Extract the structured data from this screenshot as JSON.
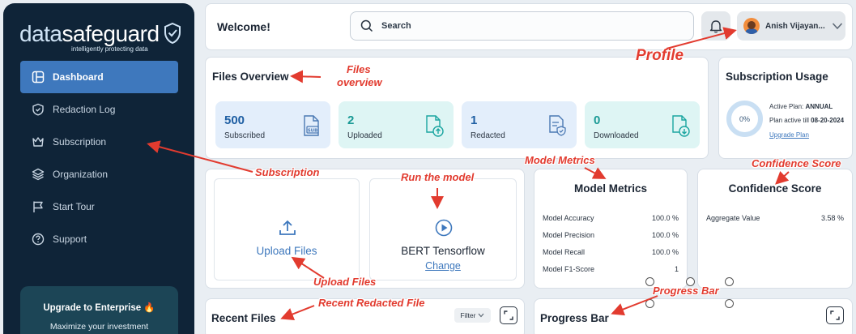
{
  "brand": {
    "name_part1": "data",
    "name_part2": "safeguard",
    "tagline": "intelligently protecting data"
  },
  "sidebar": {
    "items": [
      {
        "label": "Dashboard",
        "icon": "dashboard-icon"
      },
      {
        "label": "Redaction Log",
        "icon": "shield-icon"
      },
      {
        "label": "Subscription",
        "icon": "crown-icon"
      },
      {
        "label": "Organization",
        "icon": "layers-icon"
      },
      {
        "label": "Start Tour",
        "icon": "flag-icon"
      },
      {
        "label": "Support",
        "icon": "help-icon"
      }
    ],
    "upgrade": {
      "title": "Upgrade to Enterprise",
      "subtitle": "Maximize your investment"
    }
  },
  "header": {
    "welcome": "Welcome!",
    "search_placeholder": "Search",
    "user_name": "Anish Vijayan..."
  },
  "files_overview": {
    "title": "Files Overview",
    "stats": [
      {
        "value": "500",
        "label": "Subscribed",
        "color": "#e3eefb"
      },
      {
        "value": "2",
        "label": "Uploaded",
        "color": "#def5f4"
      },
      {
        "value": "1",
        "label": "Redacted",
        "color": "#e3eefb"
      },
      {
        "value": "0",
        "label": "Downloaded",
        "color": "#def5f4"
      }
    ]
  },
  "subscription_usage": {
    "title": "Subscription Usage",
    "percent": "0%",
    "active_plan_label": "Active Plan:",
    "active_plan_value": "ANNUAL",
    "active_till_label": "Plan active till",
    "active_till_value": "08-20-2024",
    "upgrade_link": "Upgrade Plan"
  },
  "upload": {
    "label": "Upload Files"
  },
  "model": {
    "name": "BERT Tensorflow",
    "change": "Change"
  },
  "model_metrics": {
    "title": "Model Metrics",
    "rows": [
      {
        "label": "Model Accuracy",
        "value": "100.0 %"
      },
      {
        "label": "Model Precision",
        "value": "100.0 %"
      },
      {
        "label": "Model Recall",
        "value": "100.0 %"
      },
      {
        "label": "Model F1-Score",
        "value": "1"
      }
    ]
  },
  "confidence": {
    "title": "Confidence Score",
    "label": "Aggregate Value",
    "value": "3.58 %"
  },
  "recent_files": {
    "title": "Recent Files",
    "filter": "Filter"
  },
  "progress_bar": {
    "title": "Progress Bar"
  },
  "annotations": {
    "files_overview_1": "Files",
    "files_overview_2": "overview",
    "profile": "Profile",
    "subscription": "Subscription",
    "run_model": "Run the model",
    "model_metrics": "Model Metrics",
    "confidence_score": "Confidence Score",
    "upload_files": "Upload Files",
    "progress_bar": "Progress Bar",
    "recent_redacted": "Recent Redacted File",
    "color": "#e23b2f"
  }
}
